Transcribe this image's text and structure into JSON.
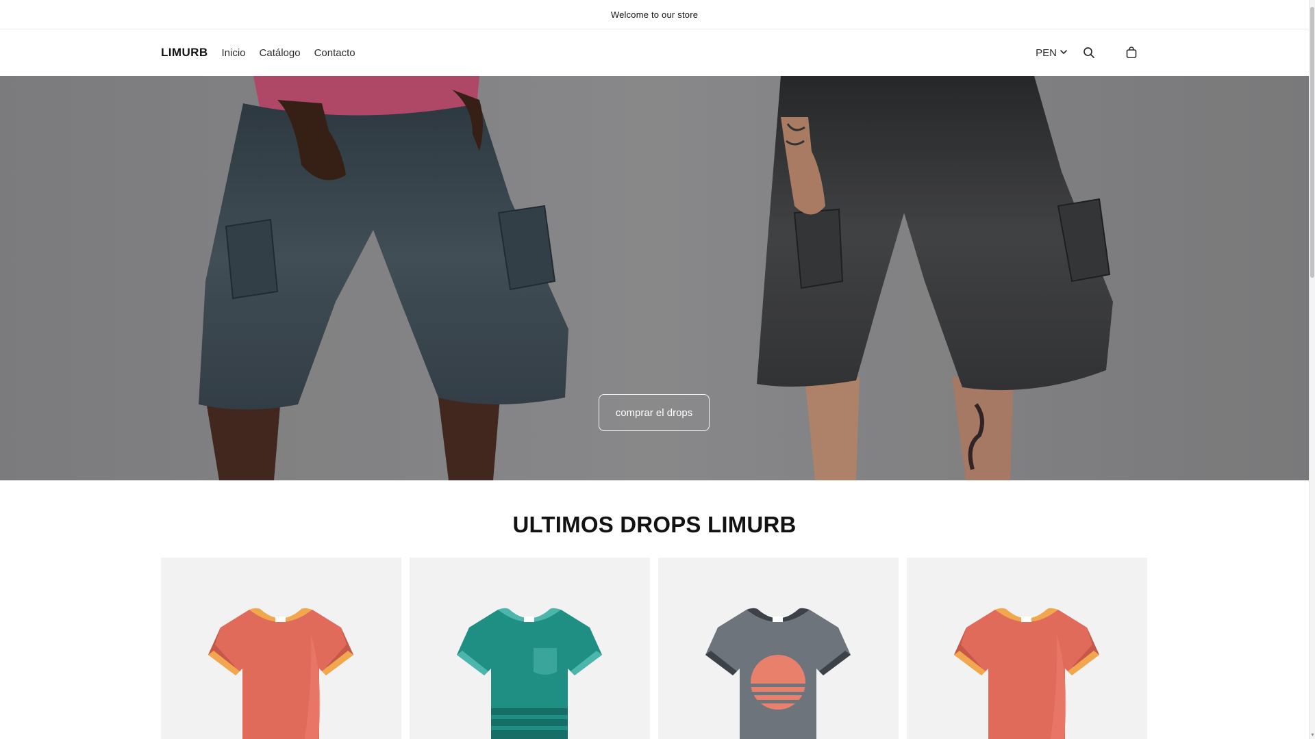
{
  "announcement": {
    "text": "Welcome to our store"
  },
  "header": {
    "logo": "LIMURB",
    "nav": [
      {
        "label": "Inicio"
      },
      {
        "label": "Catálogo"
      },
      {
        "label": "Contacto"
      }
    ],
    "currency": "PEN",
    "icons": [
      "chevron-down-icon",
      "search-icon",
      "bag-icon"
    ]
  },
  "hero": {
    "button_label": "comprar el drops"
  },
  "products": {
    "title": "ULTIMOS DROPS LIMURB",
    "items": [
      {
        "name": "tshirt-coral",
        "body_color": "#e06b5a",
        "collar_color": "#f0a74e"
      },
      {
        "name": "tshirt-teal",
        "body_color": "#1f8f84",
        "collar_color": "#4cb6ad"
      },
      {
        "name": "tshirt-gray",
        "body_color": "#6e747b",
        "collar_color": "#3d4248"
      },
      {
        "name": "tshirt-coral",
        "body_color": "#e06b5a",
        "collar_color": "#f0a74e"
      }
    ]
  }
}
